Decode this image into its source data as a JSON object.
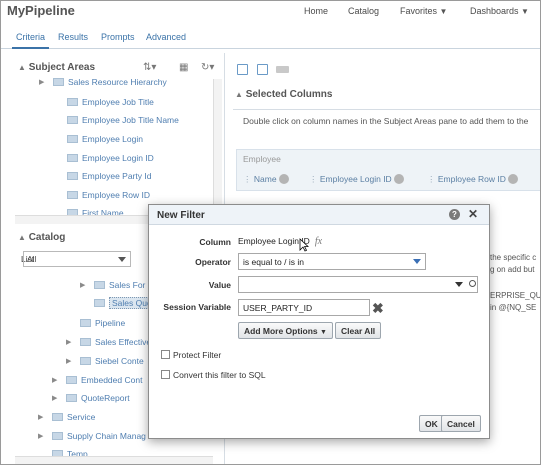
{
  "app": {
    "title": "MyPipeline"
  },
  "topnav": [
    {
      "label": "Home"
    },
    {
      "label": "Catalog"
    },
    {
      "label": "Favorites"
    },
    {
      "label": "Dashboards"
    }
  ],
  "tabs": [
    "Criteria",
    "Results",
    "Prompts",
    "Advanced"
  ],
  "subject_areas": {
    "title": "Subject Areas",
    "items": [
      "Sales Resource Hierarchy",
      "Employee Job Title",
      "Employee Job Title Name",
      "Employee Login",
      "Employee Login ID",
      "Employee Party Id",
      "Employee Row ID",
      "First Name"
    ]
  },
  "catalog": {
    "title": "Catalog",
    "list_label": "List",
    "list_value": "All",
    "items": [
      "Sales For",
      "Sales Quo",
      "Pipeline",
      "Sales Effective",
      "Siebel Conte",
      "Embedded Cont",
      "QuoteReport",
      "Service",
      "Supply Chain Manag",
      "Temp"
    ]
  },
  "selected_columns": {
    "title": "Selected Columns",
    "hint": "Double click on column names in the Subject Areas pane to add them to the",
    "group": "Employee",
    "chips": [
      "Name",
      "Employee Login ID",
      "Employee Row ID"
    ]
  },
  "background_text": {
    "line1": "the specific c",
    "line2": "g on add but",
    "line3": "ERPRISE_QU",
    "line4": "in @{NQ_SE"
  },
  "dialog": {
    "title": "New Filter",
    "help": "?",
    "column_label": "Column",
    "column_value": "Employee Login ID",
    "fx": "fx",
    "operator_label": "Operator",
    "operator_value": "is equal to / is in",
    "value_label": "Value",
    "value_value": "",
    "session_label": "Session Variable",
    "session_value": "USER_PARTY_ID",
    "add_more_options": "Add More Options",
    "clear_all": "Clear All",
    "protect_filter": "Protect Filter",
    "convert_sql": "Convert this filter to SQL",
    "ok": "OK",
    "cancel": "Cancel"
  }
}
